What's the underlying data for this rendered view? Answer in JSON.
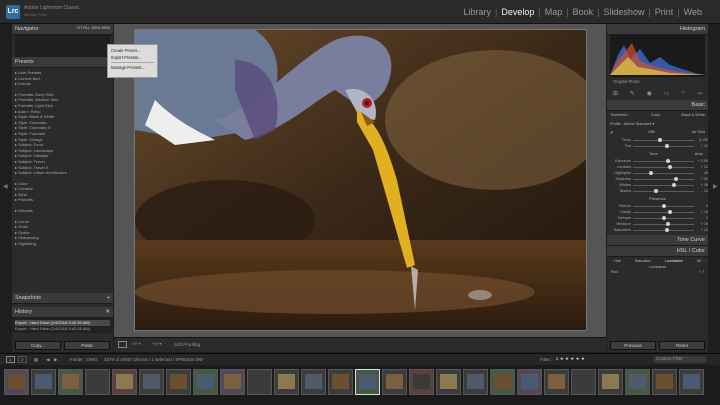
{
  "app": {
    "name": "Adobe Lightroom Classic",
    "logo": "Lrc",
    "identity": "Identity Plate"
  },
  "modules": [
    "Library",
    "Develop",
    "Map",
    "Book",
    "Slideshow",
    "Print",
    "Web"
  ],
  "active_module": "Develop",
  "left_panel": {
    "navigator": {
      "title": "Navigator",
      "zoom": "FIT  FILL  100%  200%"
    },
    "presets": {
      "title": "Presets",
      "items": [
        "User Presets",
        "Current Bert",
        "Europe",
        "",
        "Portraits: Deep Skin",
        "Portraits: Medium Skin",
        "Portraits: Light Skin",
        "Auto+: Retro",
        "Style: Black & White",
        "Style: Cinematic",
        "Style: Cinematic II",
        "Style: Futuristic",
        "Style: Vintage",
        "Subject: Food",
        "Subject: Landscape",
        "Subject: Lifestyle",
        "Subject: Travel",
        "Subject: Travel II",
        "Subject: Urban Architecture",
        "",
        "Color",
        "Creative",
        "B&W",
        "Portraits",
        "",
        "Defaults",
        "",
        "Curve",
        "Grain",
        "Optics",
        "Sharpening",
        "Vignetting"
      ]
    },
    "snapshots": {
      "title": "Snapshots"
    },
    "history": {
      "title": "History",
      "items": [
        "Export - Hard Drive (2/4/2018 9:42:39 AM)",
        "Export - Hard Drive (2/4/2018 9:42:28 AM)"
      ]
    },
    "buttons": {
      "copy": "Copy...",
      "paste": "Paste"
    }
  },
  "context_menu": {
    "items": [
      "Create Preset...",
      "Import Presets...",
      "Manage Presets..."
    ]
  },
  "right_panel": {
    "histogram_title": "Histogram",
    "original_photo": "Original Photo",
    "basic": {
      "title": "Basic",
      "treatment": "Treatment :",
      "color": "Color",
      "bw": "Black & White",
      "profile": "Profile :",
      "profile_value": "Adobe Standard",
      "wb": "WB :",
      "wb_value": "As Shot",
      "tone": "Tone",
      "auto": "Auto",
      "presence": "Presence"
    },
    "sliders": [
      {
        "label": "Temp",
        "value": "5,150",
        "pos": 0.45
      },
      {
        "label": "Tint",
        "value": "+ 12",
        "pos": 0.55
      },
      {
        "label": "Exposure",
        "value": "+ 0.50",
        "pos": 0.58
      },
      {
        "label": "Contrast",
        "value": "+ 22",
        "pos": 0.6
      },
      {
        "label": "Highlights",
        "value": "- 48",
        "pos": 0.3
      },
      {
        "label": "Shadows",
        "value": "+ 40",
        "pos": 0.7
      },
      {
        "label": "Whites",
        "value": "+ 38",
        "pos": 0.68
      },
      {
        "label": "Blacks",
        "value": "- 24",
        "pos": 0.38
      },
      {
        "label": "Texture",
        "value": "0",
        "pos": 0.5
      },
      {
        "label": "Clarity",
        "value": "+ 18",
        "pos": 0.6
      },
      {
        "label": "Dehaze",
        "value": "0",
        "pos": 0.5
      },
      {
        "label": "Vibrance",
        "value": "+ 15",
        "pos": 0.58
      },
      {
        "label": "Saturation",
        "value": "+ 10",
        "pos": 0.56
      }
    ],
    "tone_curve": "Tone Curve",
    "hsl": {
      "title": "HSL / Color",
      "tabs": [
        "Hue",
        "Saturation",
        "Luminance",
        "All"
      ],
      "luminance": "Luminance",
      "red": "Red",
      "red_value": "+ 7"
    },
    "buttons": {
      "previous": "Previous",
      "reset": "Reset"
    }
  },
  "toolbar": {
    "soft_proofing": "Soft Proofing"
  },
  "filmstrip": {
    "pages": [
      "1",
      "2"
    ],
    "folder": "Folder : DWO",
    "count": "1679 of 44607 photos / 1 selected / IPR8349.ORF",
    "filter": "Filter :",
    "custom_filter": "Custom Filter"
  }
}
